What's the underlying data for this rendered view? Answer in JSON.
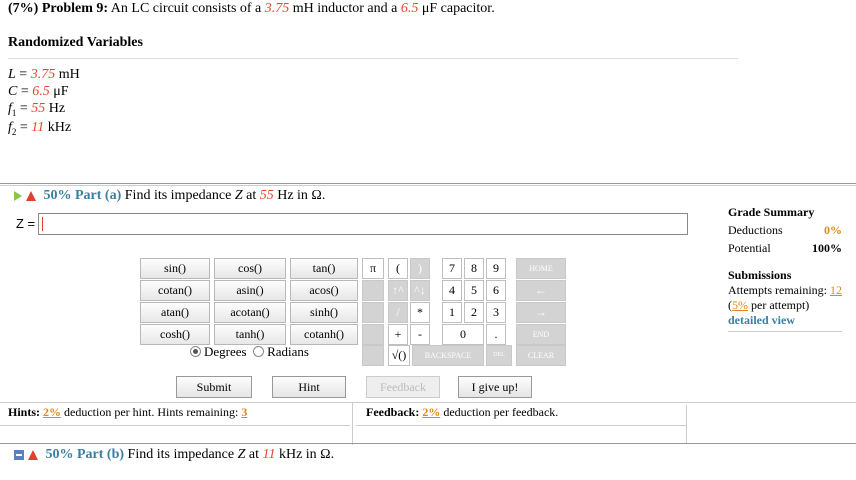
{
  "problem": {
    "prefix": "(7%)",
    "label": "Problem 9:",
    "text_a": "An LC circuit consists of a",
    "L_val": "3.75",
    "text_b": "mH inductor and a",
    "C_val": "6.5",
    "text_c": "μF capacitor."
  },
  "randomized": {
    "title": "Randomized Variables",
    "vars": [
      {
        "name": "L",
        "eq": " = ",
        "val": "3.75",
        "unit": " mH"
      },
      {
        "name": "C",
        "eq": " = ",
        "val": "6.5",
        "unit": " μF"
      },
      {
        "name": "f",
        "sub": "1",
        "eq": " = ",
        "val": "55",
        "unit": " Hz"
      },
      {
        "name": "f",
        "sub": "2",
        "eq": " = ",
        "val": "11",
        "unit": " kHz"
      }
    ]
  },
  "part_a": {
    "pct": "50% Part (a)",
    "text": "Find its impedance",
    "var": "Z",
    "at": "at",
    "freq": "55",
    "unit": "Hz in Ω."
  },
  "answer": {
    "label": "Z =",
    "value": ""
  },
  "grade": {
    "title": "Grade Summary",
    "deductions_label": "Deductions",
    "deductions_value": "0%",
    "potential_label": "Potential",
    "potential_value": "100%"
  },
  "submissions": {
    "title": "Submissions",
    "attempts_label": "Attempts remaining:",
    "attempts_value": "12",
    "per_attempt_pct": "5%",
    "per_attempt_text": "per attempt)",
    "detailed": "detailed view"
  },
  "funcs": [
    [
      "sin()",
      "cos()",
      "tan()"
    ],
    [
      "cotan()",
      "asin()",
      "acos()"
    ],
    [
      "atan()",
      "acotan()",
      "sinh()"
    ],
    [
      "cosh()",
      "tanh()",
      "cotanh()"
    ]
  ],
  "keys": {
    "pi": "π",
    "lparen": "(",
    "rparen": ")",
    "k7": "7",
    "k8": "8",
    "k9": "9",
    "home": "HOME",
    "up": "↑^",
    "up2": "^↓",
    "k4": "4",
    "k5": "5",
    "k6": "6",
    "left": "←",
    "slash": "/",
    "star": "*",
    "k1": "1",
    "k2": "2",
    "k3": "3",
    "right": "→",
    "plus": "+",
    "minus": "-",
    "k0": "0",
    "dot": ".",
    "end": "END",
    "sqrt": "√()",
    "backspace": "BACKSPACE",
    "del": "DEL",
    "clear": "CLEAR"
  },
  "angle": {
    "degrees": "Degrees",
    "radians": "Radians"
  },
  "actions": {
    "submit": "Submit",
    "hint": "Hint",
    "feedback": "Feedback",
    "giveup": "I give up!"
  },
  "hints": {
    "label": "Hints:",
    "pct": "2%",
    "text": "deduction per hint. Hints remaining:",
    "remaining": "3"
  },
  "feedback": {
    "label": "Feedback:",
    "pct": "2%",
    "text": "deduction per feedback."
  },
  "part_b": {
    "pct": "50% Part (b)",
    "text": "Find its impedance",
    "var": "Z",
    "at": "at",
    "freq": "11",
    "unit": "kHz in Ω."
  },
  "colors": {
    "random_value": "#e8442c",
    "part_title": "#3a7fa0",
    "link_orange": "#e0881a"
  }
}
